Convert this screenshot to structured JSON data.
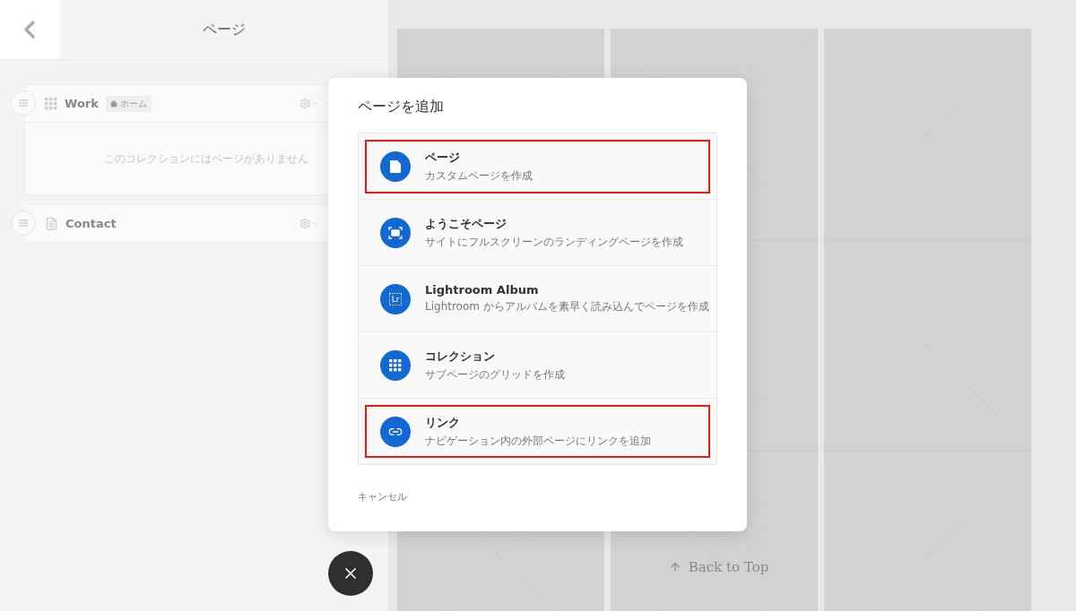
{
  "sidebar": {
    "title": "ページ",
    "items": [
      {
        "kind": "collection",
        "name": "Work",
        "badge": "ホーム",
        "empty_text": "このコレクションにはページがありません"
      },
      {
        "kind": "page",
        "name": "Contact"
      }
    ]
  },
  "dialog": {
    "title": "ページを追加",
    "options": [
      {
        "kind": "page",
        "title": "ページ",
        "description": "カスタムページを作成",
        "highlighted": true
      },
      {
        "kind": "welcome",
        "title": "ようこそページ",
        "description": "サイトにフルスクリーンのランディングページを作成",
        "highlighted": false
      },
      {
        "kind": "lightroom",
        "icon_text": "Lr",
        "title": "Lightroom Album",
        "description": "Lightroom からアルバムを素早く読み込んでページを作成",
        "highlighted": false
      },
      {
        "kind": "collection",
        "title": "コレクション",
        "description": "サブページのグリッドを作成",
        "highlighted": false
      },
      {
        "kind": "link",
        "title": "リンク",
        "description": "ナビゲーション内の外部ページにリンクを追加",
        "highlighted": true
      }
    ],
    "cancel": "キャンセル"
  },
  "back_to_top": "Back to Top"
}
